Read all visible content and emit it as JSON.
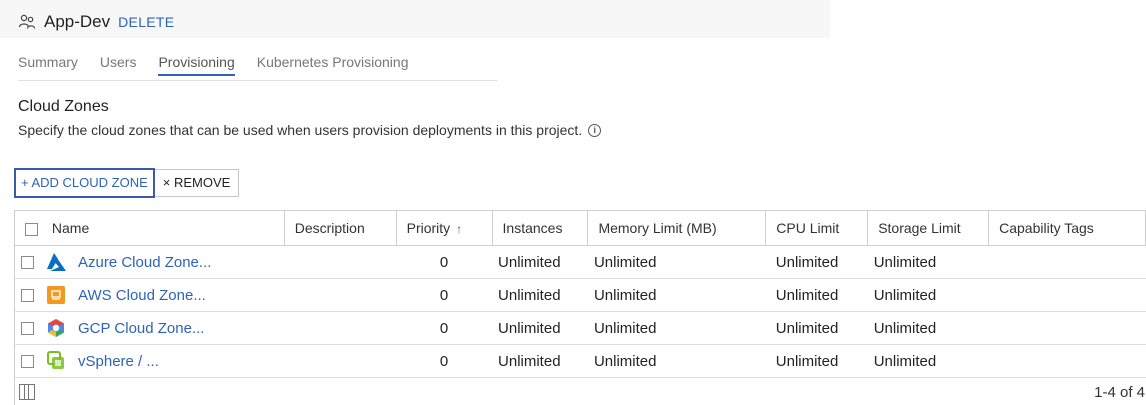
{
  "project": {
    "icon": "group-icon",
    "title": "App-Dev",
    "delete_label": "DELETE"
  },
  "tabs": [
    {
      "label": "Summary",
      "active": false
    },
    {
      "label": "Users",
      "active": false
    },
    {
      "label": "Provisioning",
      "active": true
    },
    {
      "label": "Kubernetes Provisioning",
      "active": false
    }
  ],
  "section": {
    "title": "Cloud Zones",
    "description": "Specify the cloud zones that can be used when users provision deployments in this project.",
    "info_icon": "info-icon"
  },
  "actions": {
    "add_label": "+ ADD CLOUD ZONE",
    "remove_label": "× REMOVE"
  },
  "table": {
    "columns": [
      "Name",
      "Description",
      "Priority",
      "Instances",
      "Memory Limit (MB)",
      "CPU Limit",
      "Storage Limit",
      "Capability Tags"
    ],
    "sort_indicator": "↑",
    "rows": [
      {
        "icon": "azure-icon",
        "name": "Azure Cloud Zone...",
        "description": "",
        "priority": "0",
        "instances": "Unlimited",
        "memory": "Unlimited",
        "cpu": "Unlimited",
        "storage": "Unlimited",
        "tags": ""
      },
      {
        "icon": "aws-icon",
        "name": "AWS Cloud Zone...",
        "description": "",
        "priority": "0",
        "instances": "Unlimited",
        "memory": "Unlimited",
        "cpu": "Unlimited",
        "storage": "Unlimited",
        "tags": ""
      },
      {
        "icon": "gcp-icon",
        "name": "GCP Cloud Zone...",
        "description": "",
        "priority": "0",
        "instances": "Unlimited",
        "memory": "Unlimited",
        "cpu": "Unlimited",
        "storage": "Unlimited",
        "tags": ""
      },
      {
        "icon": "vsphere-icon",
        "name": "vSphere / ...",
        "description": "",
        "priority": "0",
        "instances": "Unlimited",
        "memory": "Unlimited",
        "cpu": "Unlimited",
        "storage": "Unlimited",
        "tags": ""
      }
    ]
  },
  "footer": {
    "pagination": "1-4 of 4",
    "column_toggle_icon": "columns-icon"
  },
  "colors": {
    "accent": "#2d63b8",
    "azure": "#0a6fc2",
    "aws": "#f29a1f",
    "gcp_red": "#e8453c",
    "gcp_yellow": "#f9bb2d",
    "gcp_blue": "#4a89f3",
    "vsphere": "#78be20"
  }
}
